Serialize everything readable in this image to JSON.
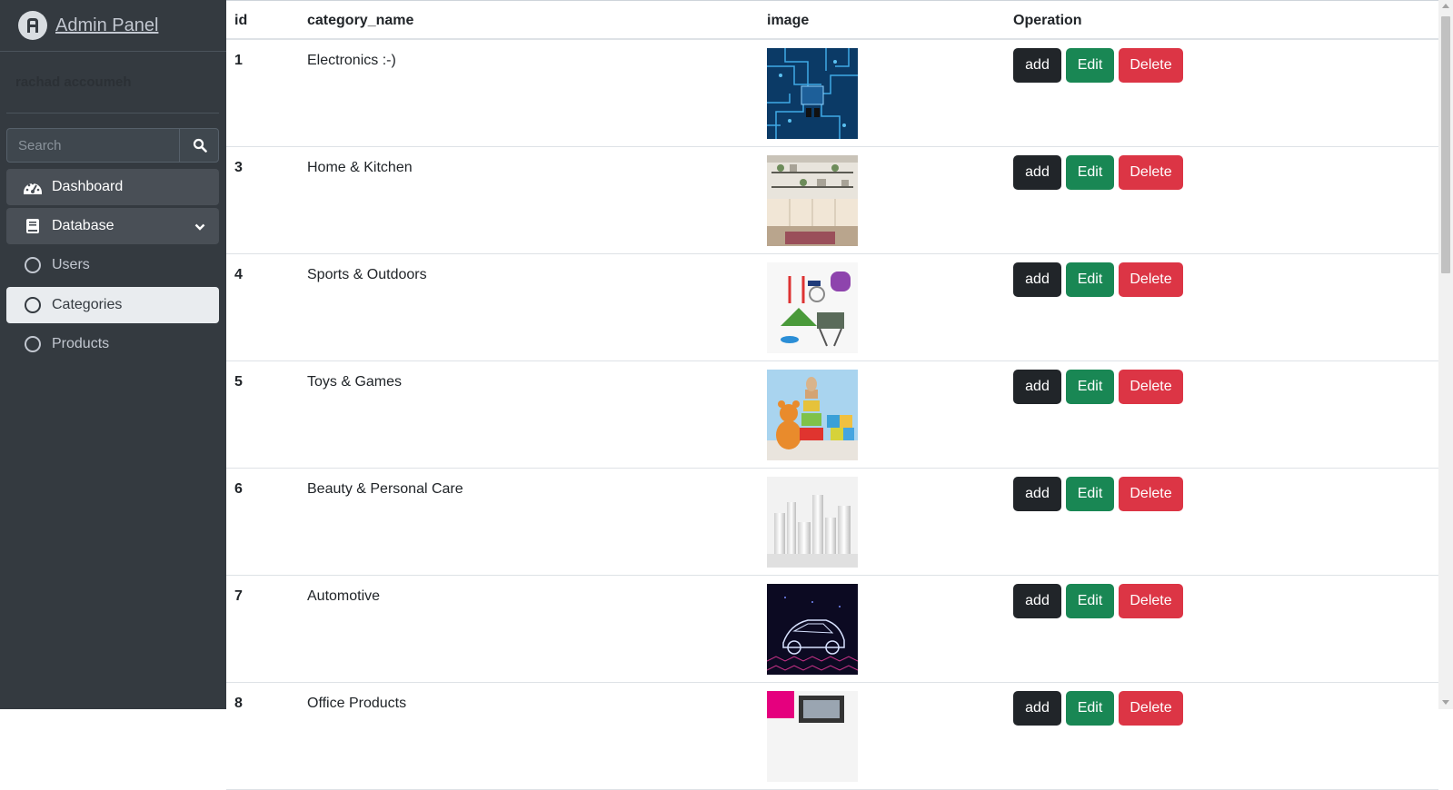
{
  "brand": {
    "title": "Admin Panel",
    "logo_icon": "admin-logo-icon"
  },
  "user": {
    "name": "rachad accoumeh"
  },
  "search": {
    "placeholder": "Search",
    "icon": "search-icon"
  },
  "sidebar": {
    "items": [
      {
        "label": "Dashboard",
        "icon": "tachometer-icon"
      },
      {
        "label": "Database",
        "icon": "book-icon"
      },
      {
        "label": "Users",
        "icon": "circle-icon"
      },
      {
        "label": "Categories",
        "icon": "circle-icon",
        "active": true
      },
      {
        "label": "Products",
        "icon": "circle-icon"
      }
    ]
  },
  "table": {
    "headers": [
      "id",
      "category_name",
      "image",
      "Operation"
    ],
    "rows": [
      {
        "id": "1",
        "category_name": "Electronics :-)",
        "image": "circuit-board-image"
      },
      {
        "id": "3",
        "category_name": "Home & Kitchen",
        "image": "kitchen-image"
      },
      {
        "id": "4",
        "category_name": "Sports & Outdoors",
        "image": "sports-gear-image"
      },
      {
        "id": "5",
        "category_name": "Toys & Games",
        "image": "toys-image"
      },
      {
        "id": "6",
        "category_name": "Beauty & Personal Care",
        "image": "cosmetics-bottles-image"
      },
      {
        "id": "7",
        "category_name": "Automotive",
        "image": "car-wireframe-image"
      },
      {
        "id": "8",
        "category_name": "Office Products",
        "image": "office-desk-image"
      }
    ],
    "buttons": {
      "add": "add",
      "edit": "Edit",
      "delete": "Delete"
    }
  },
  "colors": {
    "sidebar_bg": "#343a40",
    "active_item_bg": "#e9ecef",
    "add": "#212529",
    "edit": "#198754",
    "delete": "#dc3545"
  }
}
